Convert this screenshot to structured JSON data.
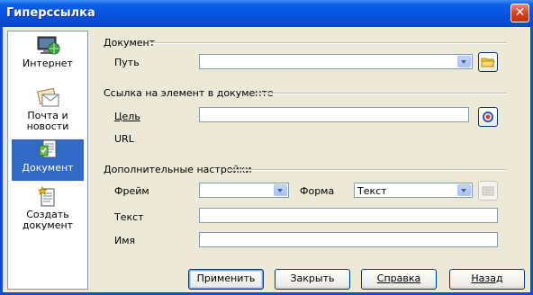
{
  "window": {
    "title": "Гиперссылка",
    "close_symbol": "✕"
  },
  "sidebar": {
    "items": [
      {
        "label_line1": "Интернет",
        "label_line2": "",
        "icon": "internet-globe-icon",
        "selected": false
      },
      {
        "label_line1": "Почта и",
        "label_line2": "новости",
        "icon": "mail-news-icon",
        "selected": false
      },
      {
        "label_line1": "Документ",
        "label_line2": "",
        "icon": "document-icon",
        "selected": true
      },
      {
        "label_line1": "Создать",
        "label_line2": "документ",
        "icon": "new-document-icon",
        "selected": false
      }
    ]
  },
  "document_group": {
    "heading": "Документ",
    "path_label": "Путь",
    "path_value": ""
  },
  "target_group": {
    "heading": "Ссылка на элемент в документе",
    "target_label": "Цель",
    "target_value": "",
    "url_label": "URL"
  },
  "extra_group": {
    "heading": "Дополнительные настройки",
    "frame_label": "Фрейм",
    "frame_value": "",
    "form_label": "Форма",
    "form_value": "Текст",
    "text_label": "Текст",
    "text_value": "",
    "name_label": "Имя",
    "name_value": ""
  },
  "buttons": {
    "apply": "Применить",
    "close": "Закрыть",
    "help": "Справка",
    "back": "Назад"
  }
}
